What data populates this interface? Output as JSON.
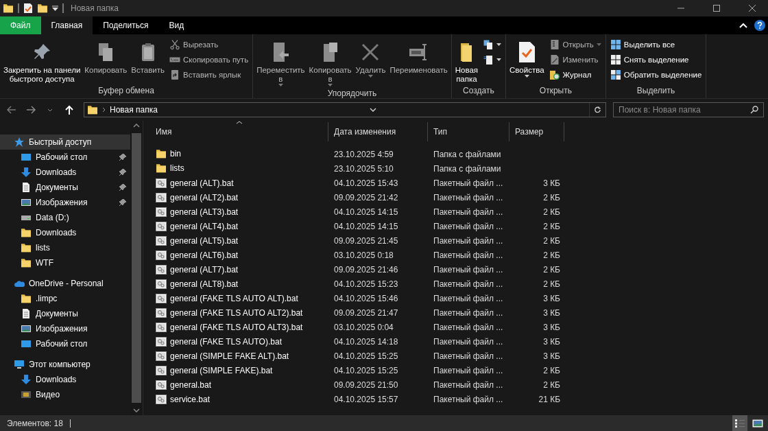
{
  "window": {
    "title": "Новая папка"
  },
  "menu_tabs": [
    {
      "label": "Файл",
      "kind": "file",
      "selected": false
    },
    {
      "label": "Главная",
      "kind": "tab",
      "selected": true
    },
    {
      "label": "Поделиться",
      "kind": "tab",
      "selected": false
    },
    {
      "label": "Вид",
      "kind": "tab",
      "selected": false
    }
  ],
  "ribbon": [
    {
      "label": "Буфер обмена",
      "buttons": [
        {
          "label": "Закрепить на панели\nбыстрого доступа",
          "kind": "pin",
          "disabled": false,
          "dropdown": false
        },
        {
          "label": "Копировать",
          "kind": "copy",
          "disabled": true,
          "dropdown": false
        },
        {
          "label": "Вставить",
          "kind": "paste",
          "disabled": true,
          "dropdown": false
        },
        {
          "items": [
            {
              "label": "Вырезать",
              "kind": "scissors",
              "disabled": true,
              "dropdown": false
            },
            {
              "label": "Скопировать путь",
              "kind": "path",
              "disabled": true,
              "dropdown": false
            },
            {
              "label": "Вставить ярлык",
              "kind": "shortcut",
              "disabled": true,
              "dropdown": false
            }
          ]
        }
      ]
    },
    {
      "label": "Упорядочить",
      "buttons": [
        {
          "label": "Переместить\nв",
          "kind": "move",
          "disabled": true,
          "dropdown": true
        },
        {
          "label": "Копировать\nв",
          "kind": "copyto",
          "disabled": true,
          "dropdown": true
        },
        {
          "label": "Удалить",
          "kind": "delete",
          "disabled": true,
          "dropdown": true
        },
        {
          "label": "Переименовать",
          "kind": "rename",
          "disabled": true,
          "dropdown": false
        }
      ]
    },
    {
      "label": "Создать",
      "buttons": [
        {
          "label": "Новая\nпапка",
          "kind": "folder",
          "disabled": false,
          "dropdown": false
        },
        {
          "items": [
            {
              "kind": "newitem",
              "disabled": false,
              "dropdown": true
            },
            {
              "kind": "easyaccess",
              "disabled": false,
              "dropdown": true
            }
          ]
        }
      ]
    },
    {
      "label": "Открыть",
      "buttons": [
        {
          "label": "Свойства",
          "kind": "properties",
          "disabled": false,
          "dropdown": true
        },
        {
          "items": [
            {
              "label": "Открыть",
              "kind": "open",
              "disabled": true,
              "dropdown": true
            },
            {
              "label": "Изменить",
              "kind": "edit",
              "disabled": true,
              "dropdown": false
            },
            {
              "label": "Журнал",
              "kind": "history",
              "disabled": false,
              "dropdown": false
            }
          ]
        }
      ]
    },
    {
      "label": "Выделить",
      "buttons": [
        {
          "items": [
            {
              "label": "Выделить все",
              "kind": "selectall",
              "disabled": false,
              "dropdown": false
            },
            {
              "label": "Снять выделение",
              "kind": "selectnone",
              "disabled": false,
              "dropdown": false
            },
            {
              "label": "Обратить выделение",
              "kind": "invert",
              "disabled": false,
              "dropdown": false
            }
          ]
        }
      ]
    }
  ],
  "address": {
    "path": [
      "Новая папка"
    ]
  },
  "search": {
    "placeholder": "Поиск в: Новая папка"
  },
  "sidebar": {
    "items": [
      {
        "label": "Быстрый доступ",
        "kind": "star",
        "selected": true,
        "children": [
          {
            "label": "Рабочий стол",
            "kind": "desktop",
            "pinned": true,
            "selected": false
          },
          {
            "label": "Downloads",
            "kind": "download",
            "pinned": true,
            "selected": false
          },
          {
            "label": "Документы",
            "kind": "document",
            "pinned": true,
            "selected": false
          },
          {
            "label": "Изображения",
            "kind": "pictures",
            "pinned": true,
            "selected": false
          },
          {
            "label": "Data (D:)",
            "kind": "drive",
            "pinned": false,
            "selected": false
          },
          {
            "label": "Downloads",
            "kind": "folder",
            "pinned": false,
            "selected": false
          },
          {
            "label": "lists",
            "kind": "folder",
            "pinned": false,
            "selected": false
          },
          {
            "label": "WTF",
            "kind": "folder",
            "pinned": false,
            "selected": false
          }
        ]
      },
      {
        "label": "OneDrive - Personal",
        "kind": "cloud",
        "selected": false,
        "children": [
          {
            "label": ".limpc",
            "kind": "folder",
            "pinned": false,
            "selected": false
          },
          {
            "label": "Документы",
            "kind": "document",
            "pinned": false,
            "selected": false
          },
          {
            "label": "Изображения",
            "kind": "pictures",
            "pinned": false,
            "selected": false
          },
          {
            "label": "Рабочий стол",
            "kind": "desktop",
            "pinned": false,
            "selected": false
          }
        ]
      },
      {
        "label": "Этот компьютер",
        "kind": "computer",
        "selected": false,
        "children": [
          {
            "label": "Downloads",
            "kind": "download",
            "pinned": false,
            "selected": false
          },
          {
            "label": "Видео",
            "kind": "video",
            "pinned": false,
            "selected": false
          }
        ]
      }
    ]
  },
  "table": {
    "columns": [
      {
        "label": "Имя",
        "sorted": true
      },
      {
        "label": "Дата изменения",
        "sorted": false
      },
      {
        "label": "Тип",
        "sorted": false
      },
      {
        "label": "Размер",
        "sorted": false
      }
    ],
    "rows": [
      {
        "kind": "folder",
        "name": "bin",
        "date": "23.10.2025 4:59",
        "type": "Папка с файлами"
      },
      {
        "kind": "folder",
        "name": "lists",
        "date": "23.10.2025 5:10",
        "type": "Папка с файлами"
      },
      {
        "kind": "bat",
        "name": "general (ALT).bat",
        "date": "04.10.2025 15:43",
        "type": "Пакетный файл ...",
        "size": "3 КБ"
      },
      {
        "kind": "bat",
        "name": "general (ALT2).bat",
        "date": "09.09.2025 21:42",
        "type": "Пакетный файл ...",
        "size": "2 КБ"
      },
      {
        "kind": "bat",
        "name": "general (ALT3).bat",
        "date": "04.10.2025 14:15",
        "type": "Пакетный файл ...",
        "size": "2 КБ"
      },
      {
        "kind": "bat",
        "name": "general (ALT4).bat",
        "date": "04.10.2025 14:15",
        "type": "Пакетный файл ...",
        "size": "2 КБ"
      },
      {
        "kind": "bat",
        "name": "general (ALT5).bat",
        "date": "09.09.2025 21:45",
        "type": "Пакетный файл ...",
        "size": "2 КБ"
      },
      {
        "kind": "bat",
        "name": "general (ALT6).bat",
        "date": "03.10.2025 0:18",
        "type": "Пакетный файл ...",
        "size": "2 КБ"
      },
      {
        "kind": "bat",
        "name": "general (ALT7).bat",
        "date": "09.09.2025 21:46",
        "type": "Пакетный файл ...",
        "size": "2 КБ"
      },
      {
        "kind": "bat",
        "name": "general (ALT8).bat",
        "date": "04.10.2025 15:23",
        "type": "Пакетный файл ...",
        "size": "2 КБ"
      },
      {
        "kind": "bat",
        "name": "general (FAKE TLS AUTO ALT).bat",
        "date": "04.10.2025 15:46",
        "type": "Пакетный файл ...",
        "size": "3 КБ"
      },
      {
        "kind": "bat",
        "name": "general (FAKE TLS AUTO ALT2).bat",
        "date": "09.09.2025 21:47",
        "type": "Пакетный файл ...",
        "size": "3 КБ"
      },
      {
        "kind": "bat",
        "name": "general (FAKE TLS AUTO ALT3).bat",
        "date": "03.10.2025 0:04",
        "type": "Пакетный файл ...",
        "size": "3 КБ"
      },
      {
        "kind": "bat",
        "name": "general (FAKE TLS AUTO).bat",
        "date": "04.10.2025 14:18",
        "type": "Пакетный файл ...",
        "size": "3 КБ"
      },
      {
        "kind": "bat",
        "name": "general (SIMPLE FAKE ALT).bat",
        "date": "04.10.2025 15:25",
        "type": "Пакетный файл ...",
        "size": "3 КБ"
      },
      {
        "kind": "bat",
        "name": "general (SIMPLE FAKE).bat",
        "date": "04.10.2025 15:25",
        "type": "Пакетный файл ...",
        "size": "2 КБ"
      },
      {
        "kind": "bat",
        "name": "general.bat",
        "date": "09.09.2025 21:50",
        "type": "Пакетный файл ...",
        "size": "2 КБ"
      },
      {
        "kind": "bat",
        "name": "service.bat",
        "date": "04.10.2025 15:57",
        "type": "Пакетный файл ...",
        "size": "21 КБ"
      }
    ]
  },
  "status_bar": {
    "text": "Элементов: 18",
    "views": [
      {
        "kind": "details",
        "selected": true
      },
      {
        "kind": "thumbnails",
        "selected": false
      }
    ]
  }
}
